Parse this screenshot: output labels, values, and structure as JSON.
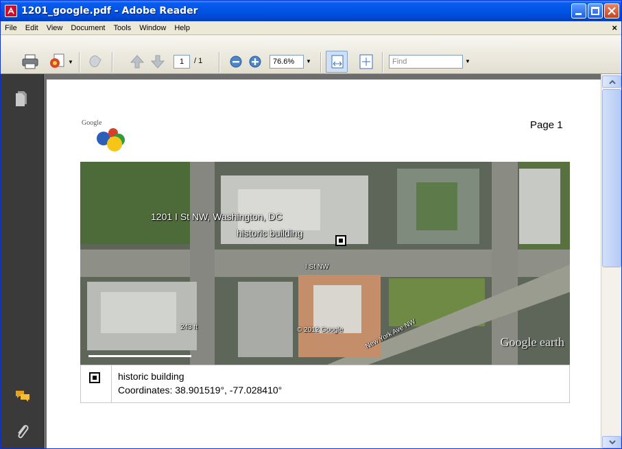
{
  "window": {
    "title": "1201_google.pdf - Adobe Reader"
  },
  "menu": {
    "items": [
      "File",
      "Edit",
      "View",
      "Document",
      "Tools",
      "Window",
      "Help"
    ],
    "close": "×"
  },
  "toolbar": {
    "page_current": "1",
    "page_total": "/ 1",
    "zoom": "76.6%",
    "find_placeholder": "Find"
  },
  "document": {
    "page_label": "Page 1",
    "logo_text": "Google",
    "map": {
      "address_label": "1201 I St NW, Washington, DC",
      "building_label": "historic building",
      "street1": "I St NW",
      "street2": "New York Ave NW",
      "scale": "243 ft",
      "copyright": "© 2012 Google",
      "watermark": "Google earth"
    },
    "legend": {
      "name": "historic building",
      "coordinates": "Coordinates: 38.901519°, -77.028410°"
    }
  },
  "colors": {
    "titlebar": "#0055e5",
    "pane": "#3a3a3a",
    "docbg": "#6d6d6d"
  }
}
